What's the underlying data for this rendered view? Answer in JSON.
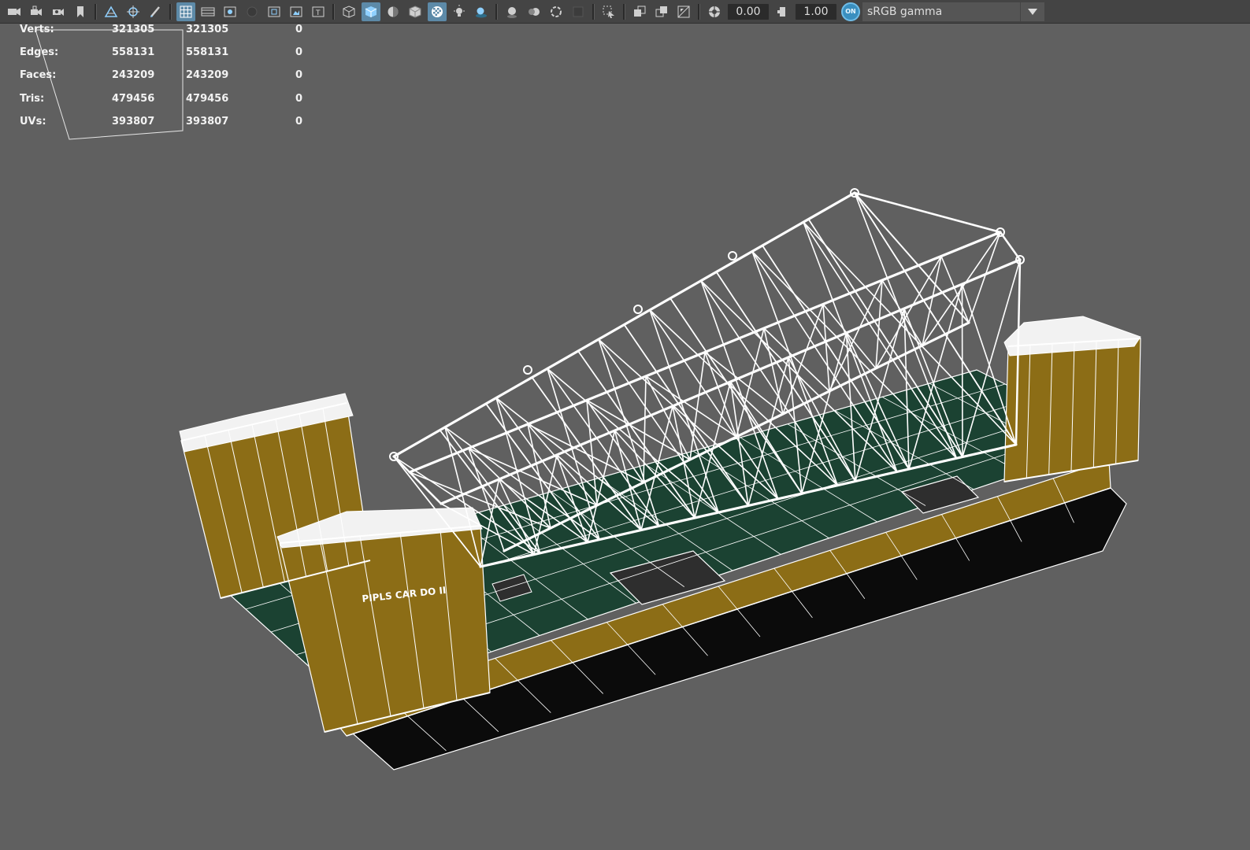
{
  "toolbar": {
    "exposure_value": "0.00",
    "gamma_value": "1.00",
    "color_management_badge": "ON",
    "view_transform": "sRGB gamma",
    "icons": [
      "camera-icon",
      "camera-lock-icon",
      "camera-attributes-icon",
      "bookmark-icon",
      "image-plane-icon",
      "pan-zoom-icon",
      "grease-pencil-icon",
      "grid-icon",
      "film-gate-icon",
      "resolution-gate-icon",
      "gate-mask-icon",
      "field-chart-icon",
      "safe-action-icon",
      "safe-title-icon",
      "wireframe-icon",
      "smooth-shade-icon",
      "wireframe-on-shaded-icon",
      "textured-icon",
      "xray-icon",
      "lights-icon",
      "shadows-icon",
      "ambient-occlusion-icon",
      "motion-blur-icon",
      "anti-aliasing-icon",
      "depth-of-field-icon",
      "isolate-select-icon",
      "xray-joints-icon",
      "xray-active-icon",
      "backface-culling-icon",
      "exposure-icon",
      "gamma-icon",
      "color-management-icon"
    ],
    "active_icons": [
      "grid-icon",
      "smooth-shade-icon",
      "textured-icon",
      "xray-icon"
    ]
  },
  "hud": {
    "rows": [
      {
        "label": "Verts:",
        "v1": "321305",
        "v2": "321305",
        "v3": "0"
      },
      {
        "label": "Edges:",
        "v1": "558131",
        "v2": "558131",
        "v3": "0"
      },
      {
        "label": "Faces:",
        "v1": "243209",
        "v2": "243209",
        "v3": "0"
      },
      {
        "label": "Tris:",
        "v1": "479456",
        "v2": "479456",
        "v3": "0"
      },
      {
        "label": "UVs:",
        "v1": "393807",
        "v2": "393807",
        "v3": "0"
      }
    ]
  },
  "model": {
    "hull_text": "PIPLS CAR DO II",
    "colors": {
      "viewport_bg": "#606060",
      "hull_gold": "#8c6d16",
      "deck_green": "#1b4232",
      "hull_black": "#0b0b0b",
      "wire_white": "#ffffff"
    }
  }
}
